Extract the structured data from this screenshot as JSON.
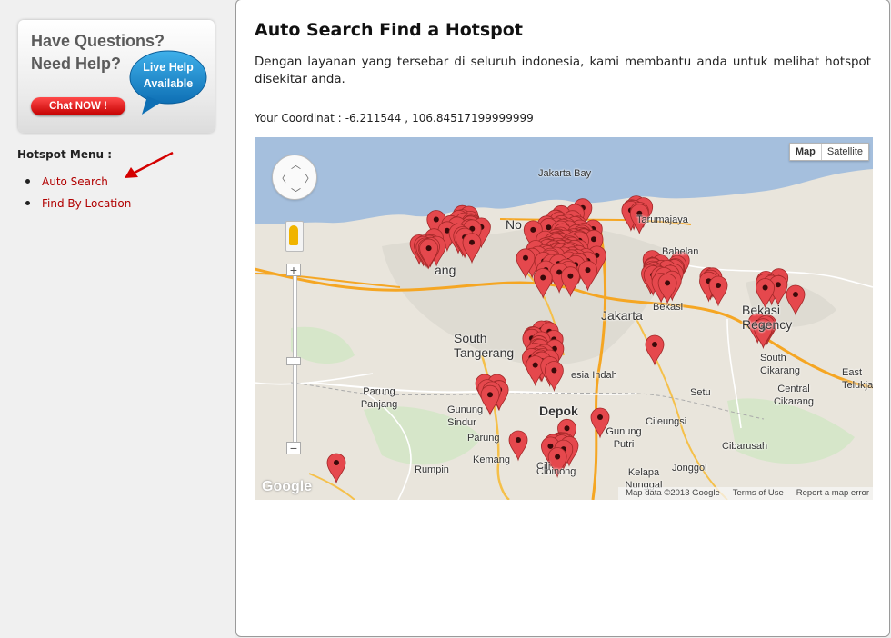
{
  "sidebar": {
    "help_banner": {
      "question_line1": "Have Questions?",
      "question_line2": "Need Help?",
      "live_help_line1": "Live Help",
      "live_help_line2": "Available",
      "chat_button": "Chat NOW !"
    },
    "menu_title": "Hotspot Menu :",
    "menu_items": [
      {
        "label": "Auto Search"
      },
      {
        "label": "Find By Location"
      }
    ]
  },
  "main": {
    "title": "Auto Search Find a Hotspot",
    "description": "Dengan layanan yang tersebar di seluruh indonesia, kami membantu anda untuk melihat hotspot disekitar anda.",
    "coordinate": {
      "label": "Your Coordinat :",
      "latitude": "-6.211544",
      "separator": ",",
      "longitude": "106.84517199999999"
    },
    "map": {
      "type_controls": [
        "Map",
        "Satellite"
      ],
      "selected_type": "Map",
      "logo": "Google",
      "attribution": [
        "Map data ©2013 Google",
        "Terms of Use",
        "Report a map error"
      ],
      "place_labels": [
        "Jakarta Bay",
        "Tarumajaya",
        "Babelan",
        "Bekasi",
        "Bekasi Regency",
        "South Tangerang",
        "Jakarta",
        "Parung Panjang",
        "Gunung Sindur",
        "Parung",
        "Depok",
        "Setu",
        "Cileungsi",
        "Cibarusah",
        "Central Cikarang",
        "South Cikarang",
        "East Telukjamb",
        "Rumpin",
        "Kemang",
        "Gunung Putri",
        "Kelapa Nunggal",
        "Jonggol",
        "Cibinong",
        "ang",
        "No",
        "esia Indah",
        "Cili"
      ],
      "marker_color": "#e5484d",
      "marker_count": 220
    }
  },
  "colors": {
    "link": "#b10000",
    "water": "#a5bfdd",
    "road_major": "#f5a623",
    "land": "#e9e5dc"
  }
}
